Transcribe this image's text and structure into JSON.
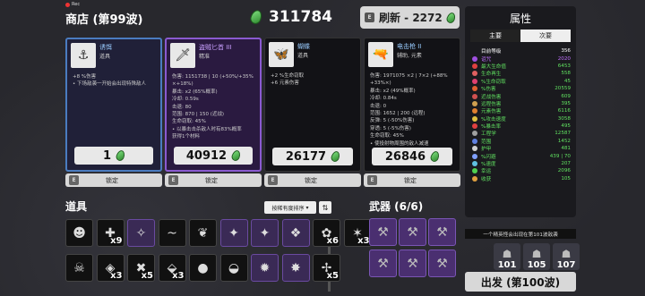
{
  "rec_label": "Rec",
  "title": "商店 (第99波)",
  "materials": "311784",
  "reroll_label": "刷新 - 2272",
  "key_hint": "E",
  "shop_items": [
    {
      "name": "诱饵",
      "sub": "道具",
      "desc": "+8 %伤害\n• 下场敌袭一开始会出现特殊敌人",
      "price": "1",
      "icon": "⚓"
    },
    {
      "name": "盗贼匕首 III",
      "sub": "精准",
      "desc": "伤害: 1151738 | 10 (+50%/+35%\n×+18%)\n暴击: x2 (65%概率)\n冷却: 0.59s\n击退: 80\n范围: 870 | 150 (近战)\n生命窃取: 45%\n• 以暴击击杀敌人时有83%概率\n  获得1个材料",
      "price": "40912",
      "icon": "🗡"
    },
    {
      "name": "蝴蝶",
      "sub": "道具",
      "desc": "+2 %生命窃取\n+6 元素伤害",
      "price": "26177",
      "icon": "🦋"
    },
    {
      "name": "电击枪 II",
      "sub": "辅助, 元素",
      "desc": "伤害: 1971075 ×2 | 7×2 (+88%\n+33%×)\n暴击: x2 (49%概率)\n冷却: 0.84s\n击退: 0\n范围: 1652 | 200 (远程)\n反弹: 5 (-50%伤害)\n穿透: 5 (-5%伤害)\n生命窃取: 45%\n• 使投射物周围的敌人减速",
      "price": "26846",
      "icon": "🔫"
    }
  ],
  "lock_label": "锁定",
  "items_title": "道具",
  "sort_label": "按稀有度排序",
  "sort_icon": "⇅",
  "inventory_row1": [
    {
      "icon": "☻",
      "count": "",
      "p": false
    },
    {
      "icon": "✚",
      "count": "x9",
      "p": false
    },
    {
      "icon": "✧",
      "count": "",
      "p": true
    },
    {
      "icon": "~",
      "count": "",
      "p": false
    },
    {
      "icon": "❦",
      "count": "",
      "p": false
    },
    {
      "icon": "✦",
      "count": "",
      "p": true
    },
    {
      "icon": "✦",
      "count": "",
      "p": true
    },
    {
      "icon": "❖",
      "count": "",
      "p": true
    },
    {
      "icon": "✿",
      "count": "x6",
      "p": false
    },
    {
      "icon": "✶",
      "count": "x3",
      "p": false
    }
  ],
  "inventory_row2": [
    {
      "icon": "☠",
      "count": "",
      "p": false
    },
    {
      "icon": "◈",
      "count": "x3",
      "p": false
    },
    {
      "icon": "✖",
      "count": "x5",
      "p": false
    },
    {
      "icon": "⬙",
      "count": "x3",
      "p": false
    },
    {
      "icon": "●",
      "count": "",
      "p": false
    },
    {
      "icon": "◒",
      "count": "",
      "p": false
    },
    {
      "icon": "✹",
      "count": "",
      "p": true
    },
    {
      "icon": "✸",
      "count": "",
      "p": true
    },
    {
      "icon": "✢",
      "count": "x5",
      "p": false
    }
  ],
  "weapons_title": "武器 (6/6)",
  "weapons": [
    "⚒",
    "⚒",
    "⚒",
    "⚒",
    "⚒",
    "⚒"
  ],
  "stats_panel": {
    "title": "属性",
    "tab_primary": "主要",
    "tab_secondary": "次要",
    "stats": [
      {
        "label": "目前等级",
        "value": "356",
        "color": "#ffffff",
        "icon": ""
      },
      {
        "label": "诅咒",
        "value": "2020",
        "color": "#c070ff",
        "icon": "#a050e0"
      },
      {
        "label": "最大生命值",
        "value": "6453",
        "color": "#60e060",
        "icon": "#e04040"
      },
      {
        "label": "生命再生",
        "value": "558",
        "color": "#60e060",
        "icon": "#e06060"
      },
      {
        "label": "%生命窃取",
        "value": "45",
        "color": "#60e060",
        "icon": "#e04070"
      },
      {
        "label": "%伤害",
        "value": "20559",
        "color": "#60e060",
        "icon": "#e06030"
      },
      {
        "label": "近战伤害",
        "value": "609",
        "color": "#60e060",
        "icon": "#d05050"
      },
      {
        "label": "远程伤害",
        "value": "395",
        "color": "#60e060",
        "icon": "#d0a050"
      },
      {
        "label": "元素伤害",
        "value": "6116",
        "color": "#60e060",
        "icon": "#e08030"
      },
      {
        "label": "%攻击速度",
        "value": "3058",
        "color": "#60e060",
        "icon": "#e0c040"
      },
      {
        "label": "%暴击率",
        "value": "495",
        "color": "#60e060",
        "icon": "#e04040"
      },
      {
        "label": "工程学",
        "value": "12587",
        "color": "#60e060",
        "icon": "#a0a0a0"
      },
      {
        "label": "范围",
        "value": "1452",
        "color": "#60e060",
        "icon": "#6080e0"
      },
      {
        "label": "护甲",
        "value": "481",
        "color": "#60e060",
        "icon": "#d0d0d0"
      },
      {
        "label": "%闪避",
        "value": "439 | 70",
        "color": "#60e060",
        "icon": "#80a0ff"
      },
      {
        "label": "%速度",
        "value": "207",
        "color": "#60e060",
        "icon": "#60c0e0"
      },
      {
        "label": "幸运",
        "value": "2096",
        "color": "#60e060",
        "icon": "#50d050"
      },
      {
        "label": "收获",
        "value": "105",
        "color": "#60e060",
        "icon": "#e0a040"
      }
    ]
  },
  "notice": "一个精英怪会出现在第101波敌袭",
  "elite_waves": [
    "101",
    "105",
    "107"
  ],
  "go_label": "出发 (第100波)"
}
